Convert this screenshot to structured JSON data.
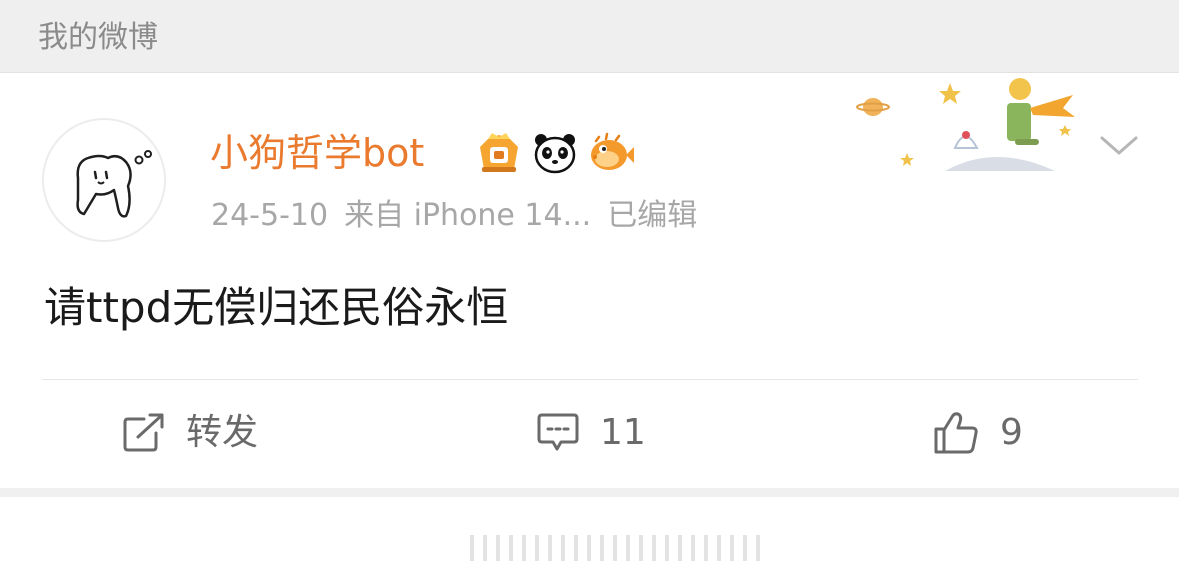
{
  "section": {
    "title": "我的微博"
  },
  "post": {
    "username": "小狗哲学bot",
    "date": "24-5-10",
    "source": "来自 iPhone 14...",
    "edited": "已编辑",
    "text": "请ttpd无偿归还民俗永恒",
    "badges": [
      "crown-badge-icon",
      "panda-badge-icon",
      "pufferfish-badge-icon"
    ]
  },
  "actions": {
    "repost_label": "转发",
    "comment_count": "11",
    "like_count": "9"
  },
  "colors": {
    "username": "#ea7a2e",
    "header_bg": "#efefef",
    "meta_text": "#a7a7a7",
    "action_text": "#6a6a6a"
  }
}
